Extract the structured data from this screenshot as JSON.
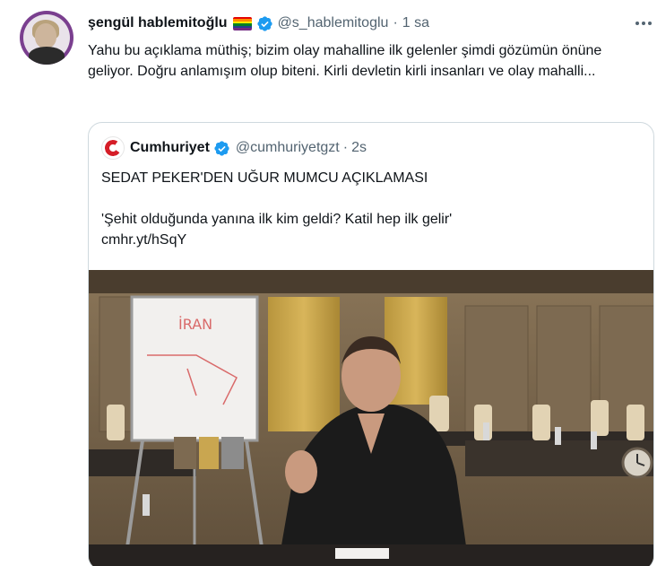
{
  "tweet": {
    "display_name": "şengül hablemitoğlu",
    "handle": "@s_hablemitoglu",
    "separator": "·",
    "time": "1 sa",
    "text": "Yahu bu açıklama müthiş; bizim olay mahalline ilk gelenler şimdi gözümün önüne geliyor. Doğru anlamışım olup biteni. Kirli devletin kirli insanları ve olay mahalli...",
    "flag_colors": [
      "#e40303",
      "#ff8c00",
      "#ffed00",
      "#008026",
      "#24408e",
      "#732982"
    ],
    "verified_icon": "verified-badge-icon",
    "more_icon": "more-options-icon"
  },
  "quoted": {
    "display_name": "Cumhuriyet",
    "handle": "@cumhuriyetgzt",
    "separator": "·",
    "time": "2s",
    "line1": "SEDAT PEKER'DEN UĞUR MUMCU AÇIKLAMASI",
    "line2": "'Şehit olduğunda yanına ilk kim geldi? Katil hep ilk gelir'",
    "link": "cmhr.yt/hSqY",
    "logo_color": "#d51d27",
    "verified_icon": "verified-badge-icon",
    "whiteboard_text": "İRAN"
  },
  "colors": {
    "verified": "#1d9bf0",
    "secondary_text": "#536471",
    "border": "#cfd9de"
  }
}
